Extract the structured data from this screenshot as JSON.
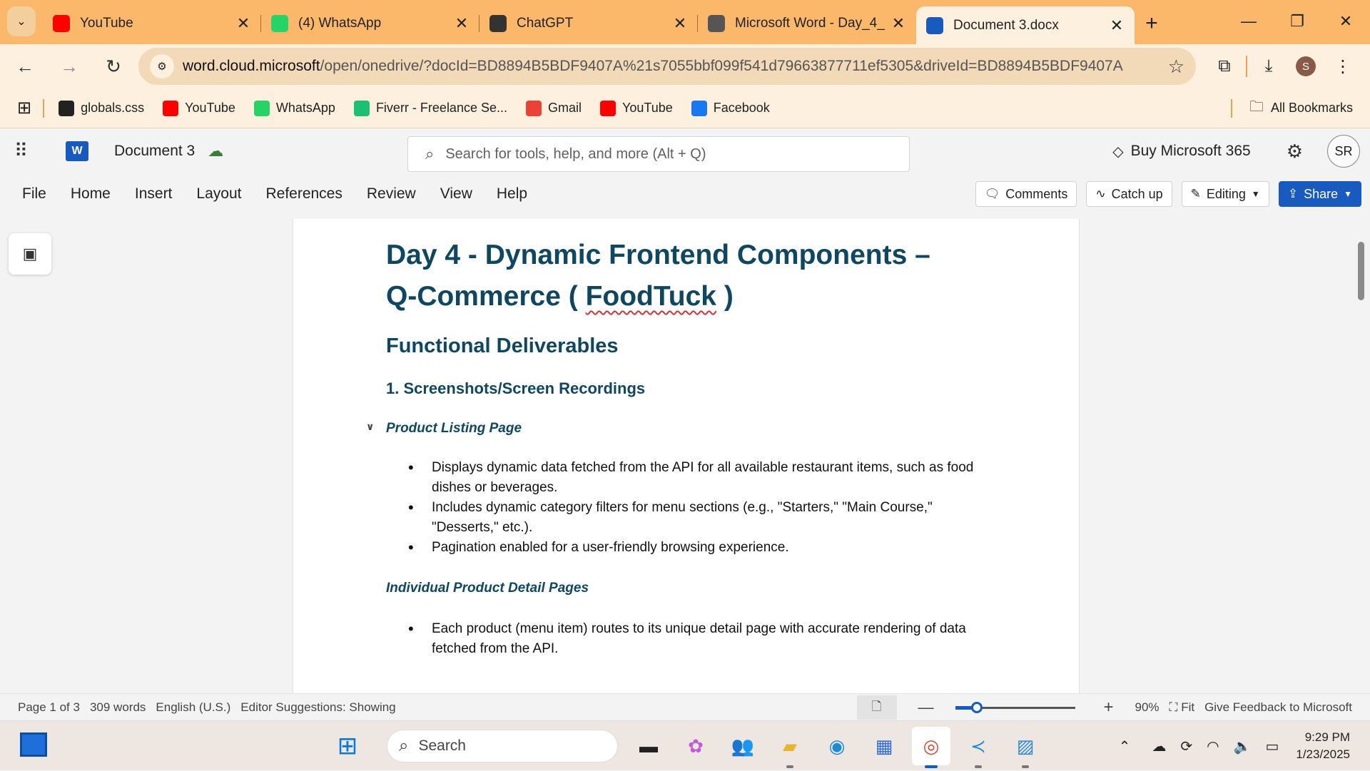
{
  "browser": {
    "tabs": [
      {
        "title": "YouTube",
        "icon": "youtube-icon",
        "color": "#ff0000",
        "active": false
      },
      {
        "title": "(4) WhatsApp",
        "icon": "whatsapp-icon",
        "color": "#25d366",
        "active": false
      },
      {
        "title": "ChatGPT",
        "icon": "chatgpt-icon",
        "color": "#333333",
        "active": false
      },
      {
        "title": "Microsoft Word - Day_4_",
        "icon": "globe-icon",
        "color": "#555555",
        "active": false
      },
      {
        "title": "Document 3.docx",
        "icon": "word-icon",
        "color": "#185abd",
        "active": true
      }
    ],
    "url_host": "word.cloud.microsoft",
    "url_rest": "/open/onedrive/?docId=BD8894B5BDF9407A%21s7055bbf099f541d79663877711ef5305&driveId=BD8894B5BDF9407A",
    "profile_initial": "S",
    "bookmarks": [
      {
        "label": "globals.css",
        "icon": "github-icon",
        "color": "#222222"
      },
      {
        "label": "YouTube",
        "icon": "youtube-icon",
        "color": "#ff0000"
      },
      {
        "label": "WhatsApp",
        "icon": "whatsapp-icon",
        "color": "#25d366"
      },
      {
        "label": "Fiverr - Freelance Se...",
        "icon": "fiverr-icon",
        "color": "#1dbf73"
      },
      {
        "label": "Gmail",
        "icon": "gmail-icon",
        "color": "#ea4335"
      },
      {
        "label": "YouTube",
        "icon": "youtube-icon",
        "color": "#ff0000"
      },
      {
        "label": "Facebook",
        "icon": "facebook-icon",
        "color": "#1877f2"
      }
    ],
    "all_bookmarks": "All Bookmarks"
  },
  "word": {
    "doc_title": "Document 3",
    "search_placeholder": "Search for tools, help, and more (Alt + Q)",
    "buy_label": "Buy Microsoft 365",
    "user_initials": "SR",
    "menu": [
      "File",
      "Home",
      "Insert",
      "Layout",
      "References",
      "Review",
      "View",
      "Help"
    ],
    "comments_label": "Comments",
    "catchup_label": "Catch up",
    "editing_label": "Editing",
    "share_label": "Share",
    "accent": "#185abd"
  },
  "document": {
    "title_line1": "Day 4 - Dynamic Frontend Components –",
    "title_line2_pre": "Q-Commerce ( ",
    "title_line2_mid": "FoodTuck",
    "title_line2_post": " )",
    "heading2": "Functional Deliverables",
    "heading3": "1. Screenshots/Screen Recordings",
    "section1_title": "Product Listing Page",
    "section1_bullets": [
      "Displays dynamic data fetched from the API for all available restaurant items, such as food dishes or beverages.",
      "Includes dynamic category filters for menu sections (e.g., \"Starters,\" \"Main Course,\" \"Desserts,\" etc.).",
      "Pagination enabled for a user-friendly browsing experience."
    ],
    "section2_title": "Individual Product Detail Pages",
    "section2_bullets": [
      "Each product (menu item) routes to its unique detail page with accurate rendering of data fetched from the API."
    ],
    "heading_color": "#0f4761"
  },
  "status": {
    "page": "Page 1 of 3",
    "words": "309 words",
    "language": "English (U.S.)",
    "editor": "Editor Suggestions: Showing",
    "zoom_value": "90%",
    "zoom_fraction": 0.18,
    "fit": "Fit",
    "feedback": "Give Feedback to Microsoft"
  },
  "taskbar": {
    "search_placeholder": "Search",
    "time": "9:29 PM",
    "date": "1/23/2025"
  }
}
